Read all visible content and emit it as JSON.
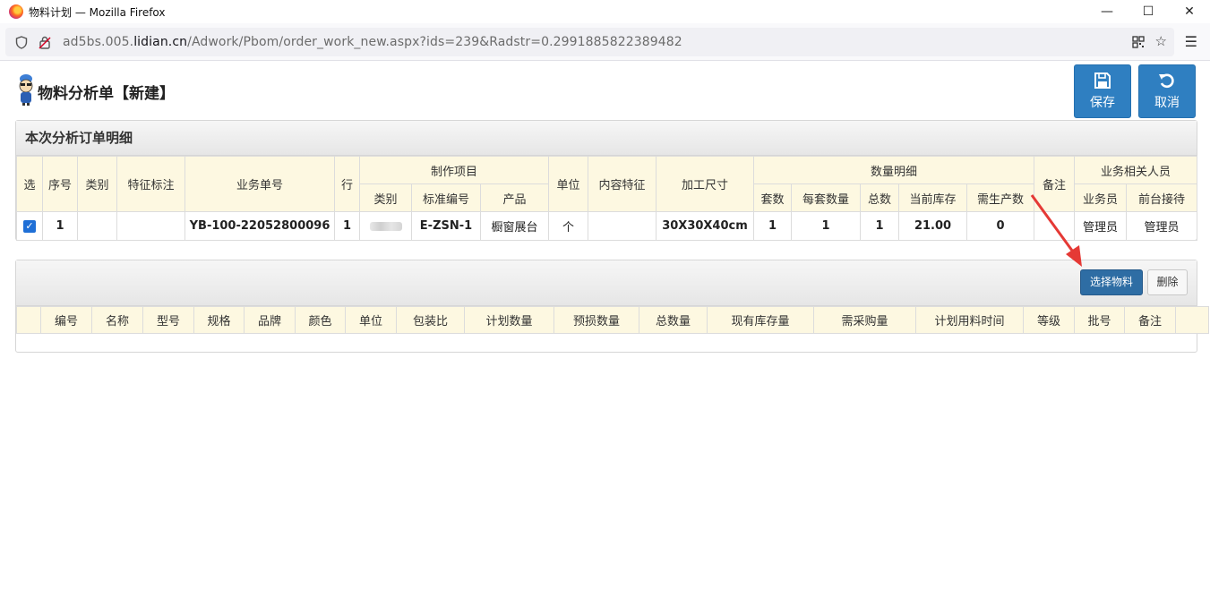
{
  "window": {
    "title": "物料计划 — Mozilla Firefox",
    "controls": {
      "minimize": "—",
      "maximize": "☐",
      "close": "✕"
    }
  },
  "urlbar": {
    "prefix": "ad5bs.005.",
    "domain": "lidian.cn",
    "path": "/Adwork/Pbom/order_work_new.aspx?ids=239&Radstr=0.2991885822389482"
  },
  "header": {
    "title": "物料分析单【新建】",
    "save_label": "保存",
    "cancel_label": "取消"
  },
  "order_panel": {
    "title": "本次分析订单明细",
    "group_headers": {
      "production": "制作项目",
      "quantity": "数量明细",
      "people": "业务相关人员"
    },
    "columns": {
      "select": "选",
      "seq": "序号",
      "category": "类别",
      "feature_mark": "特征标注",
      "order_no": "业务单号",
      "row": "行",
      "p_category": "类别",
      "p_std_no": "标准编号",
      "p_product": "产品",
      "unit": "单位",
      "content_feature": "内容特征",
      "size": "加工尺寸",
      "q_sets": "套数",
      "q_per_set": "每套数量",
      "q_total": "总数",
      "q_stock": "当前库存",
      "q_need": "需生产数",
      "remark": "备注",
      "salesperson": "业务员",
      "reception": "前台接待"
    },
    "rows": [
      {
        "checked": true,
        "seq": "1",
        "category": "",
        "feature_mark": "",
        "order_no": "YB-100-22052800096",
        "row": "1",
        "p_category": "",
        "p_std_no": "E-ZSN-1",
        "p_product": "橱窗展台",
        "unit": "个",
        "content_feature": "",
        "size": "30X30X40cm",
        "q_sets": "1",
        "q_per_set": "1",
        "q_total": "1",
        "q_stock": "21.00",
        "q_need": "0",
        "remark": "",
        "salesperson": "管理员",
        "reception": "管理员"
      }
    ]
  },
  "material_panel": {
    "select_label": "选择物料",
    "delete_label": "删除",
    "columns": [
      "编号",
      "名称",
      "型号",
      "规格",
      "品牌",
      "颜色",
      "单位",
      "包装比",
      "计划数量",
      "预损数量",
      "总数量",
      "现有库存量",
      "需采购量",
      "计划用料时间",
      "等级",
      "批号",
      "备注"
    ]
  },
  "colors": {
    "primary_button": "#2f7fc1",
    "header_cell": "#fdf8e1",
    "annotation_arrow": "#e53935"
  }
}
